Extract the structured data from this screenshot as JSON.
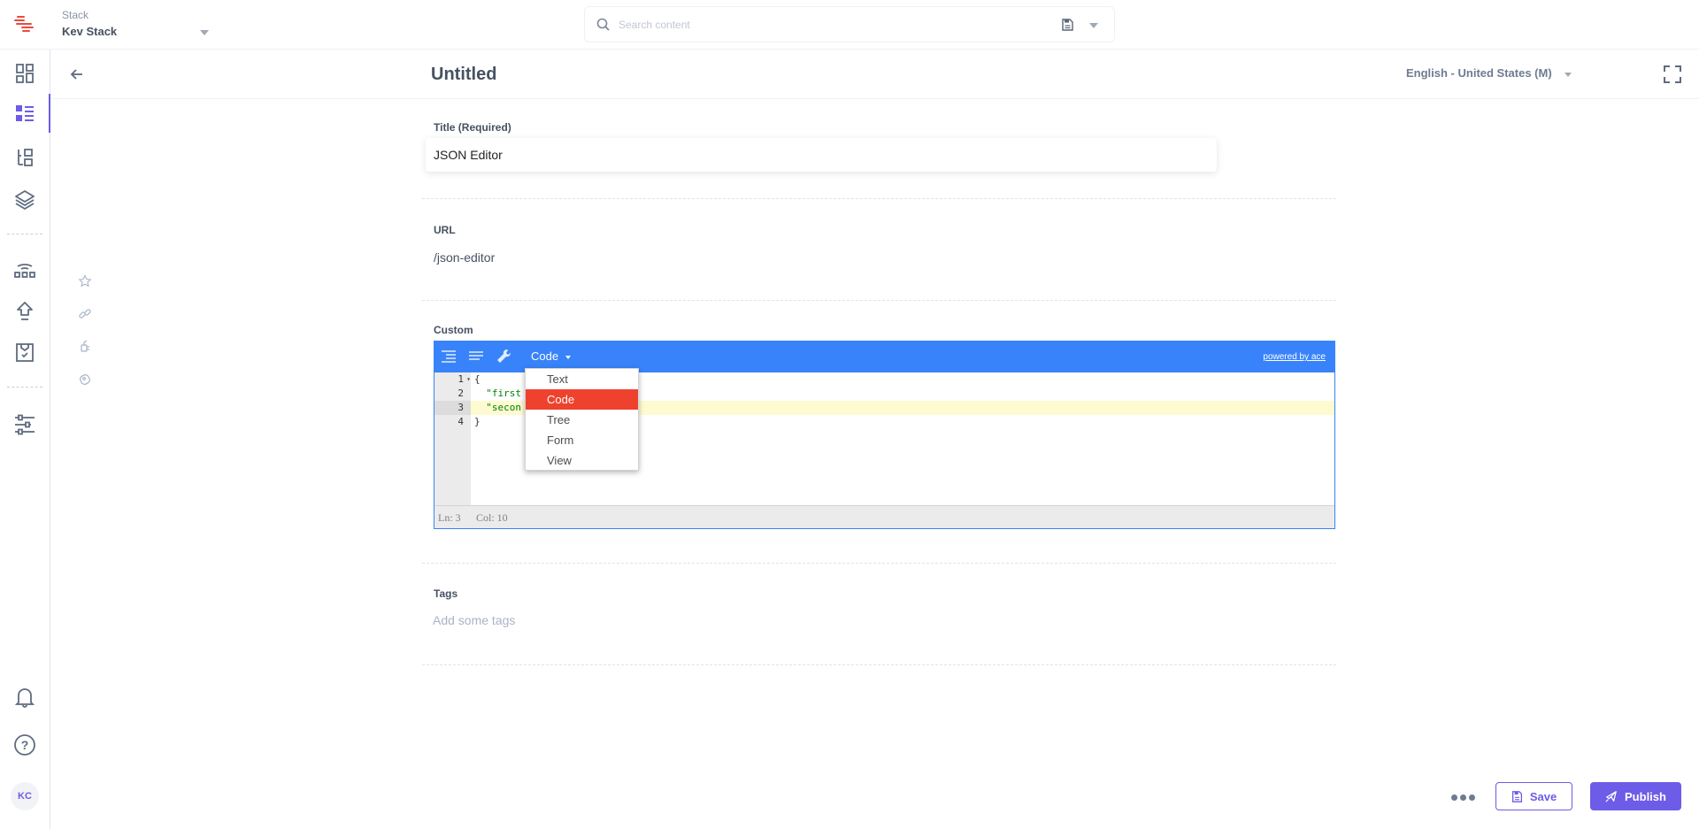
{
  "topbar": {
    "stack_label": "Stack",
    "stack_name": "Kev Stack",
    "search_placeholder": "Search content"
  },
  "sidebar": {
    "items": [
      {
        "icon": "dashboard-icon"
      },
      {
        "icon": "entries-icon",
        "active": true
      },
      {
        "icon": "content-models-icon"
      },
      {
        "icon": "assets-icon"
      },
      {
        "icon": "releases-icon"
      },
      {
        "icon": "publish-queue-icon"
      },
      {
        "icon": "tasks-icon"
      },
      {
        "icon": "settings-icon"
      }
    ],
    "bottom": [
      {
        "icon": "bell-icon"
      },
      {
        "icon": "help-icon"
      }
    ],
    "avatar_initials": "KC"
  },
  "header": {
    "title": "Untitled",
    "locale": "English - United States (M)"
  },
  "rail": [
    "star-icon",
    "link-icon",
    "plugin-icon",
    "tag-icon"
  ],
  "form": {
    "title_label": "Title (Required)",
    "title_value": "JSON Editor",
    "url_label": "URL",
    "url_value": "/json-editor",
    "custom_label": "Custom",
    "tags_label": "Tags",
    "tags_placeholder": "Add some tags"
  },
  "json_editor": {
    "mode": "Code",
    "powered_by": "powered by ace",
    "lines": [
      {
        "num": "1",
        "text": "{",
        "fold": true
      },
      {
        "num": "2",
        "text": "  \"first"
      },
      {
        "num": "3",
        "text": "  \"secon",
        "active": true
      },
      {
        "num": "4",
        "text": "}"
      }
    ],
    "status_line": "Ln: 3",
    "status_col": "Col: 10",
    "mode_options": [
      {
        "label": "Text"
      },
      {
        "label": "Code",
        "selected": true
      },
      {
        "label": "Tree"
      },
      {
        "label": "Form"
      },
      {
        "label": "View"
      }
    ]
  },
  "actions": {
    "save_label": "Save",
    "publish_label": "Publish"
  },
  "colors": {
    "accent": "#6c5ce7",
    "editor_blue": "#3883fa",
    "selected_red": "#ee422e",
    "logo_red": "#f0483e"
  }
}
